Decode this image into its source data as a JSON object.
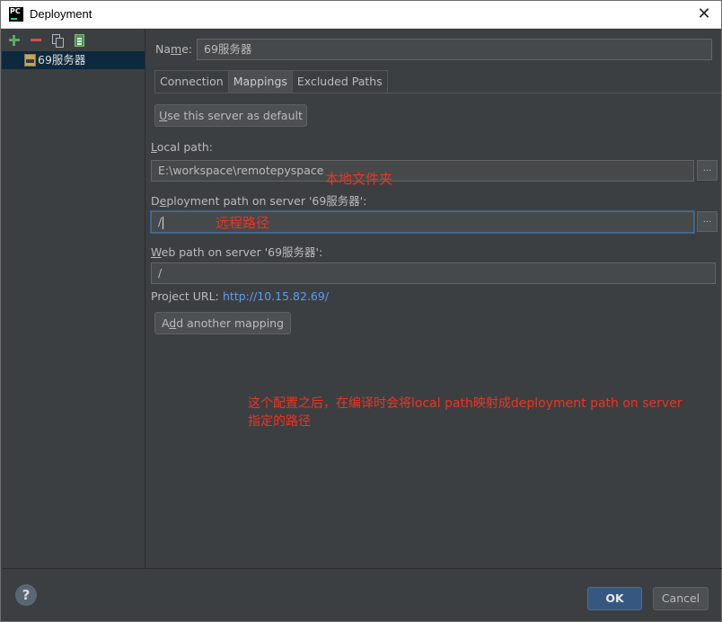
{
  "window": {
    "title": "Deployment"
  },
  "left_toolbar": {
    "add_icon": "plus-icon",
    "remove_icon": "minus-icon",
    "copy_icon": "copy-icon",
    "default_icon": "use-as-default-icon"
  },
  "server_list": {
    "items": [
      {
        "label": "69服务器",
        "icon": "sftp-server-icon"
      }
    ]
  },
  "name_field": {
    "label": "Name:",
    "label_pre": "Na",
    "label_u": "m",
    "label_post": "e:",
    "value": "69服务器"
  },
  "tabs": [
    {
      "label": "Connection"
    },
    {
      "label": "Mappings",
      "active": true
    },
    {
      "label": "Excluded Paths"
    }
  ],
  "mappings": {
    "use_default_pre": "",
    "use_default_u": "U",
    "use_default_post": "se this server as default",
    "local_path_u": "L",
    "local_path_post": "ocal path:",
    "local_path_value": "E:\\workspace\\remotepyspace",
    "deploy_path_pre": "D",
    "deploy_path_u": "e",
    "deploy_path_post": "ployment path on server '69服务器':",
    "deploy_path_value": "/",
    "web_path_u": "W",
    "web_path_post": "eb path on server '69服务器':",
    "web_path_value": "/",
    "project_url_label": "Project URL:",
    "project_url_value": "http://10.15.82.69/",
    "add_mapping_pre": "A",
    "add_mapping_u": "d",
    "add_mapping_post": "d another mapping",
    "browse_label": "..."
  },
  "annotations": {
    "local_folder": "本地文件夹",
    "remote_path": "远程路径",
    "explanation_line1": "这个配置之后，在编译时会将local path映射成deployment path on server",
    "explanation_line2": "指定的路径",
    "color": "#ee3322"
  },
  "footer": {
    "help": "?",
    "ok": "OK",
    "cancel": "Cancel"
  }
}
